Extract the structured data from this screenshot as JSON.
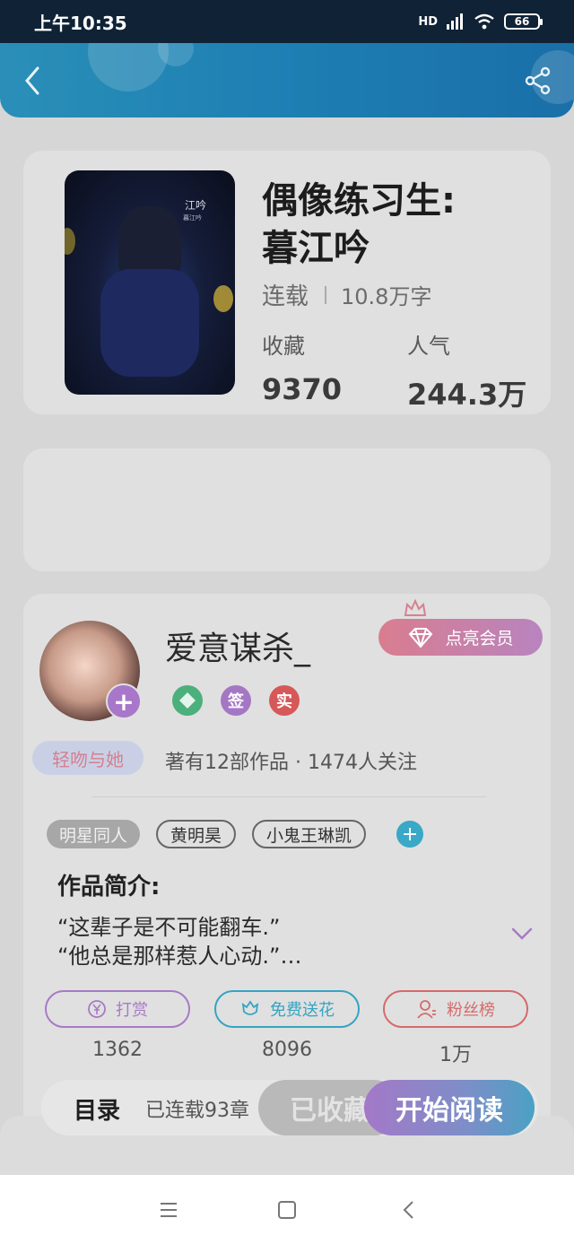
{
  "status_bar": {
    "time": "上午10:35",
    "network": "HD",
    "battery": "66"
  },
  "book": {
    "title_line1": "偶像练习生:",
    "title_line2": "暮江吟",
    "status": "连载",
    "words": "10.8万字",
    "stats": [
      {
        "label": "收藏",
        "value": "9370"
      },
      {
        "label": "人气",
        "value": "244.3万"
      }
    ],
    "cover_title": "江吟",
    "cover_subtitle": "暮江吟"
  },
  "author": {
    "name": "爱意谋杀_",
    "member_button": "点亮会员",
    "badges": [
      "签",
      "实"
    ],
    "fan_tag": "轻吻与她",
    "summary": "著有12部作品 · 1474人关注"
  },
  "tags": [
    "明星同人",
    "黄明昊",
    "小鬼王琳凯"
  ],
  "intro": {
    "heading": "作品简介:",
    "line1": "“这辈子是不可能翻车.”",
    "line2": "“他总是那样惹人心动.”…"
  },
  "actions": [
    {
      "label": "打赏",
      "count": "1362"
    },
    {
      "label": "免费送花",
      "count": "8096"
    },
    {
      "label": "粉丝榜",
      "count": "1万"
    }
  ],
  "bottom_bar": {
    "toc_label": "目录",
    "toc_status": "已连载93章",
    "collected_label": "已收藏",
    "read_label": "开始阅读"
  },
  "colors": {
    "header": "#1d7fb3",
    "accent_purple": "#a77ac5",
    "accent_teal": "#35a4c2",
    "accent_red": "#d56a6a"
  }
}
